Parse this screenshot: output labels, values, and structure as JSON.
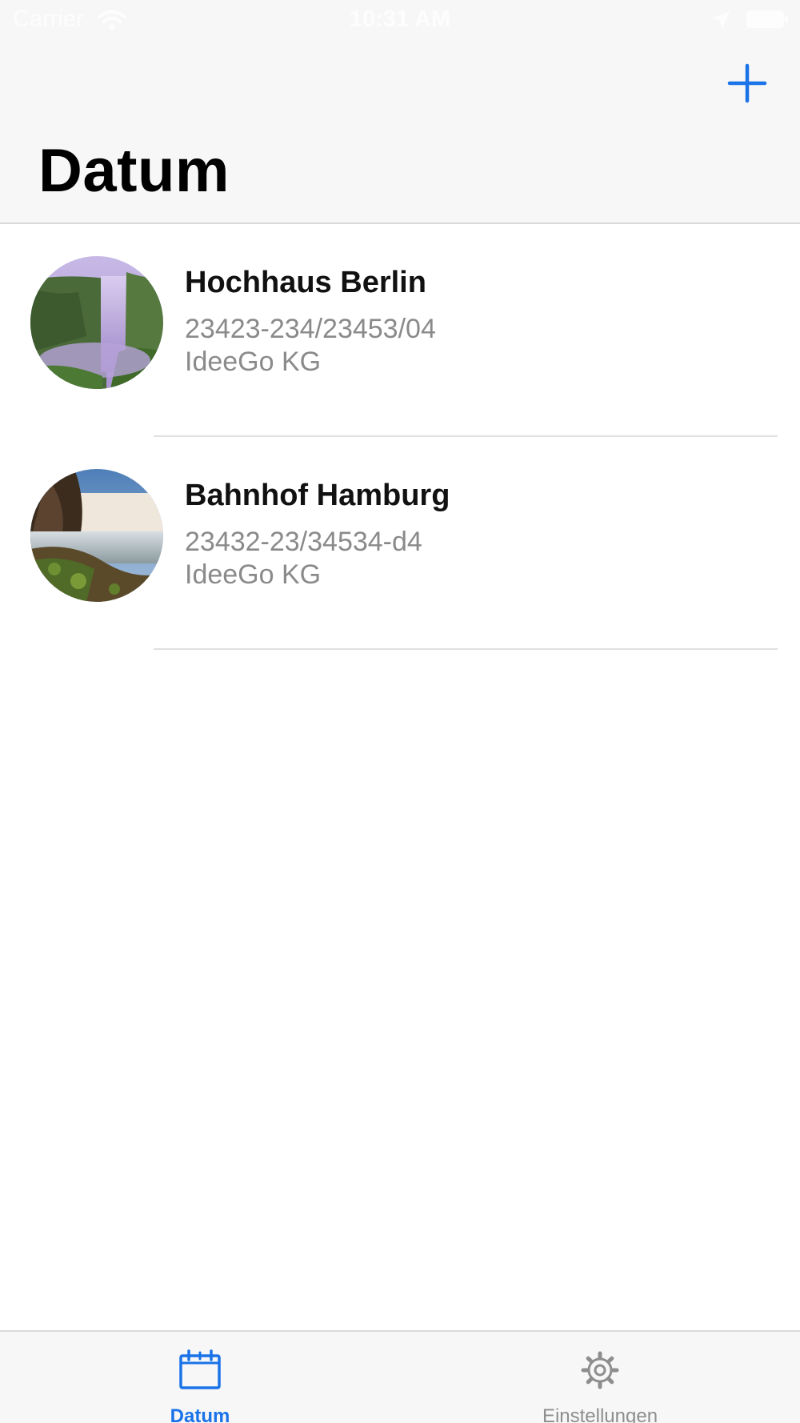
{
  "status_bar": {
    "carrier": "Carrier",
    "time": "10:31 AM",
    "icons": [
      "wifi-icon",
      "location-arrow-icon",
      "battery-icon"
    ]
  },
  "nav": {
    "title": "Datum",
    "add_icon": "plus-icon",
    "accent_color": "#1a73e8"
  },
  "items": [
    {
      "title": "Hochhaus Berlin",
      "code": "23423-234/23453/04",
      "company": "IdeeGo KG",
      "image": "waterfall-photo"
    },
    {
      "title": "Bahnhof Hamburg",
      "code": "23432-23/34534-d4",
      "company": "IdeeGo KG",
      "image": "waterfall-photo"
    }
  ],
  "tabs": [
    {
      "label": "Datum",
      "icon": "calendar-icon",
      "selected": true
    },
    {
      "label": "Einstellungen",
      "icon": "gear-icon",
      "selected": false
    }
  ],
  "colors": {
    "accent": "#1a73e8",
    "bar_background": "#f7f7f7",
    "secondary_text": "#8a8a8a",
    "inactive_tab": "#8e8e8e"
  }
}
